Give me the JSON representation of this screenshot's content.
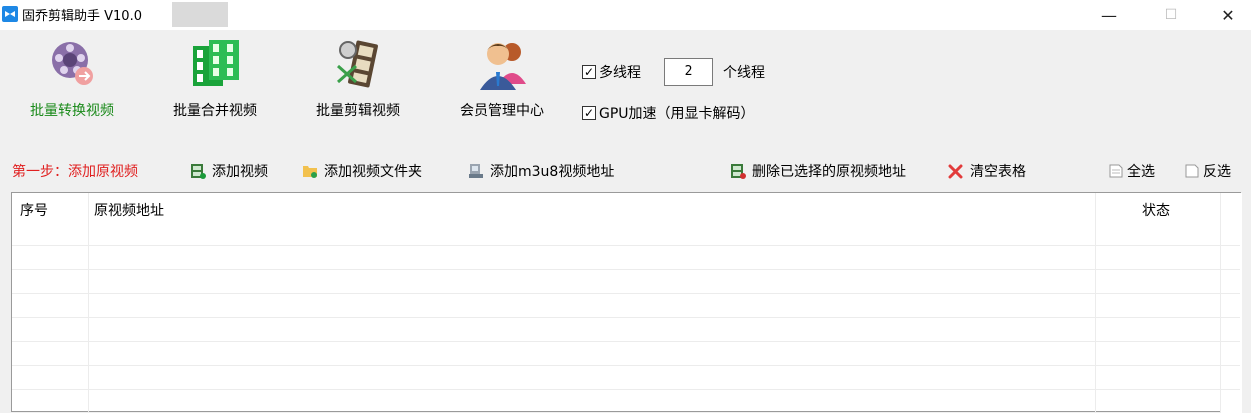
{
  "window": {
    "title": "固乔剪辑助手 V10.0",
    "minimize_glyph": "—",
    "maximize_glyph": "☐",
    "close_glyph": "✕"
  },
  "toolbar": {
    "items": [
      {
        "label": "批量转换视频",
        "icon": "film-reel-icon"
      },
      {
        "label": "批量合并视频",
        "icon": "film-merge-icon"
      },
      {
        "label": "批量剪辑视频",
        "icon": "film-cut-icon"
      },
      {
        "label": "会员管理中心",
        "icon": "user-icon"
      }
    ]
  },
  "options": {
    "multithread_label": "多线程",
    "thread_count": "2",
    "thread_unit": "个线程",
    "gpu_label": "GPU加速（用显卡解码）",
    "multithread_checked": true,
    "gpu_checked": true
  },
  "actions": {
    "step_label": "第一步：添加原视频",
    "add_video": "添加视频",
    "add_folder": "添加视频文件夹",
    "add_m3u8": "添加m3u8视频地址",
    "delete_selected": "删除已选择的原视频地址",
    "clear_table": "清空表格",
    "select_all": "全选",
    "invert_select": "反选"
  },
  "table": {
    "columns": [
      "序号",
      "原视频地址",
      "状态"
    ],
    "rows": []
  },
  "colors": {
    "accent_green": "#1a8a1a",
    "step_red": "#e02020"
  }
}
